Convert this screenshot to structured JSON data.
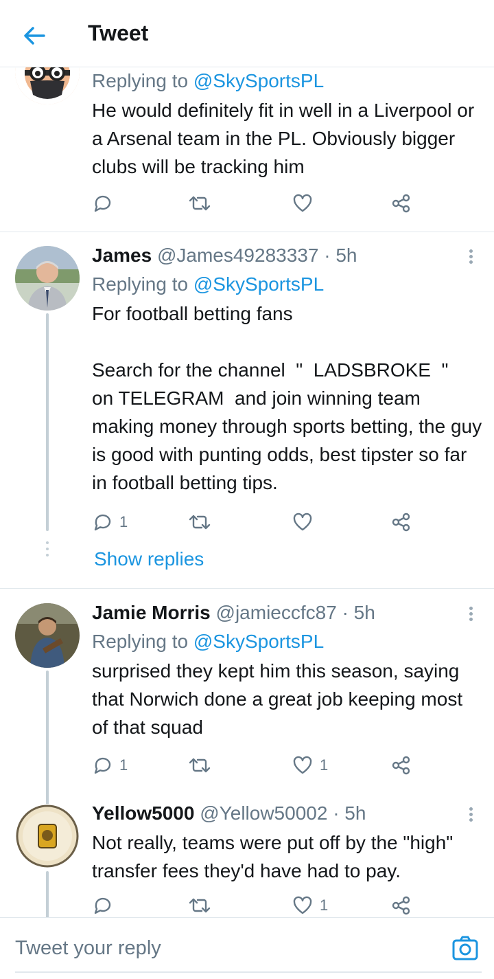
{
  "header": {
    "title": "Tweet",
    "back_icon": "arrow-left-icon"
  },
  "colors": {
    "accent": "#1b95e0",
    "text": "#14171a",
    "muted": "#657786",
    "divider": "#e1e8ed"
  },
  "tweets": [
    {
      "name": "",
      "handle": "",
      "time": "",
      "replying_prefix": "Replying to ",
      "replying_to": "@SkySportsPL",
      "text": "He would definitely fit in well in a Liverpool or a Arsenal team in the PL. Obviously bigger clubs will be tracking him",
      "reply_count": "",
      "like_count": ""
    },
    {
      "name": "James",
      "handle": "@James49283337",
      "time": "· 5h",
      "replying_prefix": "Replying to ",
      "replying_to": "@SkySportsPL",
      "text": "For football betting fans\n\nSearch for the channel  \"  LADSBROKE  \"\non TELEGRAM  and join winning team making money through sports betting, the guy is good with punting odds, best tipster so far in football betting tips.",
      "reply_count": "1",
      "like_count": "",
      "show_replies": "Show replies"
    },
    {
      "name": "Jamie Morris",
      "handle": "@jamieccfc87",
      "time": "· 5h",
      "replying_prefix": "Replying to ",
      "replying_to": "@SkySportsPL",
      "text": "surprised they kept him this season, saying that Norwich done a great job keeping most of that squad",
      "reply_count": "1",
      "like_count": "1"
    },
    {
      "name": "Yellow5000",
      "handle": "@Yellow50002",
      "time": "· 5h",
      "replying_prefix": "",
      "replying_to": "",
      "text": "Not really, teams were put off by the \"high\" transfer fees they'd have had to pay.",
      "reply_count": "",
      "like_count": "1"
    }
  ],
  "composer": {
    "placeholder": "Tweet your reply",
    "camera_icon": "camera-icon"
  }
}
